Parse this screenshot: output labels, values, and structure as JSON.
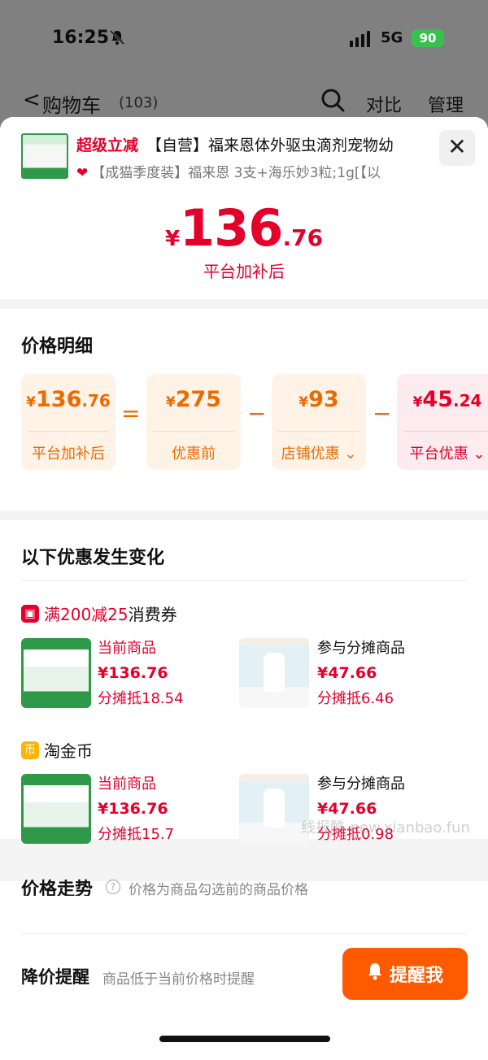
{
  "status_bar": {
    "time": "16:25",
    "network": "5G",
    "battery": "90"
  },
  "nav": {
    "back_glyph": "<",
    "title": "购物车",
    "count": "(103)",
    "compare": "对比",
    "manage": "管理"
  },
  "product": {
    "tag": "超级立减",
    "title": "【自营】福来恩体外驱虫滴剂宠物幼",
    "subtitle": "【成猫季度装】福来恩 3支+海乐妙3粒;1g[【以",
    "price_symbol": "¥",
    "price_int": "136",
    "price_dec": ".76",
    "price_label": "平台加补后"
  },
  "price_detail": {
    "title": "价格明细",
    "boxes": [
      {
        "symbol": "¥",
        "int": "136",
        "dec": ".76",
        "label": "平台加补后",
        "style": "orange"
      },
      {
        "symbol": "¥",
        "int": "275",
        "dec": "",
        "label": "优惠前",
        "style": "orange"
      },
      {
        "symbol": "¥",
        "int": "93",
        "dec": "",
        "label": "店铺优惠",
        "style": "orange"
      },
      {
        "symbol": "¥",
        "int": "45",
        "dec": ".24",
        "label": "平台优惠",
        "style": "pink"
      }
    ],
    "operators": [
      "=",
      "−",
      "−"
    ]
  },
  "changes": {
    "title": "以下优惠发生变化",
    "promos": [
      {
        "name_highlight": "满200减25",
        "name_rest": "消费券",
        "icon": "coupon-icon",
        "items": [
          {
            "role": "当前商品",
            "price": "¥136.76",
            "share": "分摊抵18.54"
          },
          {
            "role": "参与分摊商品",
            "price": "¥47.66",
            "share": "分摊抵6.46"
          }
        ]
      },
      {
        "name_highlight": "",
        "name_rest": "淘金币",
        "icon": "coin-icon",
        "items": [
          {
            "role": "当前商品",
            "price": "¥136.76",
            "share": "分摊抵15.7"
          },
          {
            "role": "参与分摊商品",
            "price": "¥47.66",
            "share": "分摊抵0.98"
          }
        ]
      }
    ]
  },
  "trend": {
    "title": "价格走势",
    "desc": "价格为商品勾选前的商品价格"
  },
  "remind": {
    "title": "降价提醒",
    "desc": "商品低于当前价格时提醒",
    "button": "提醒我"
  },
  "watermark": "线报酷-new.xianbao.fun",
  "colors": {
    "accent_red": "#e4002b",
    "accent_orange": "#ff5a00",
    "battery_green": "#37c24b"
  }
}
